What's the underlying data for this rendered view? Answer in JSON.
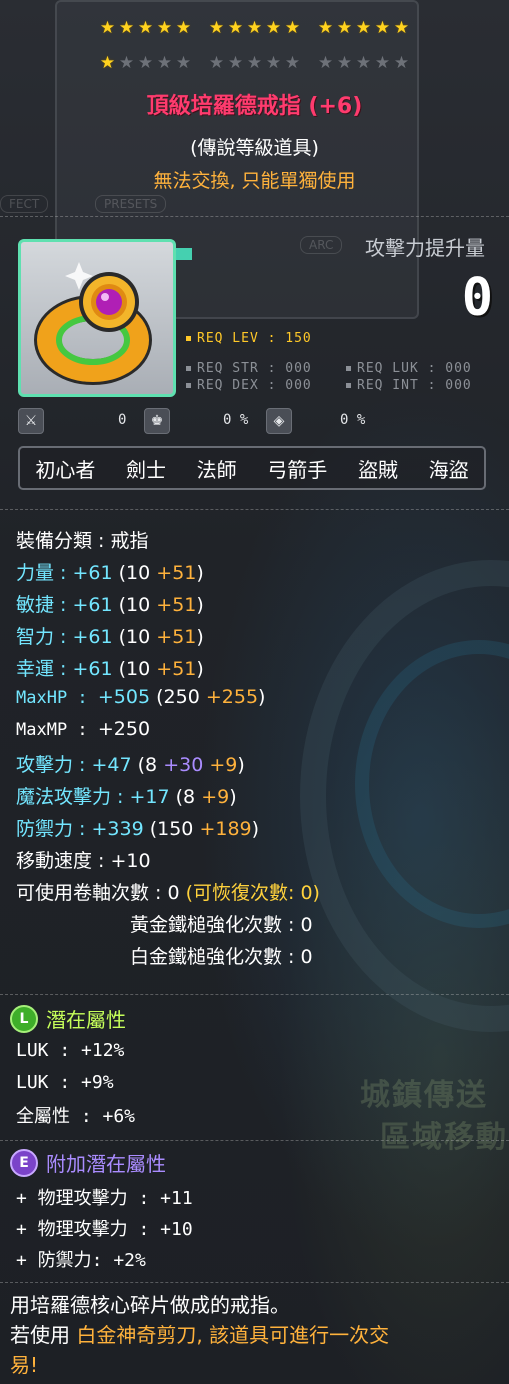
{
  "stars": {
    "total_row1": 15,
    "total_row2": 15,
    "filled_row2": 1
  },
  "item": {
    "name": "頂級培羅德戒指",
    "enhance": "(+6)",
    "grade": "(傳說等級道具)",
    "trade": "無法交換, 只能單獨使用"
  },
  "attack_increase": {
    "label": "攻擊力提升量",
    "value": "0"
  },
  "requirements": {
    "lev": "REQ LEV : 150",
    "str": "REQ STR : 000",
    "luk": "REQ LUK : 000",
    "dex": "REQ DEX : 000",
    "int": "REQ INT : 000"
  },
  "small_stats": {
    "v1": "0",
    "v2": "0 %",
    "v3": "0 %"
  },
  "jobs": [
    "初心者",
    "劍士",
    "法師",
    "弓箭手",
    "盜賊",
    "海盜"
  ],
  "category": {
    "label": "裝備分類 : ",
    "value": "戒指"
  },
  "stats": [
    {
      "label": "力量 : ",
      "total": "+61",
      "base": "(10 ",
      "bonus": "+51",
      "close": ")"
    },
    {
      "label": "敏捷 : ",
      "total": "+61",
      "base": "(10 ",
      "bonus": "+51",
      "close": ")"
    },
    {
      "label": "智力 : ",
      "total": "+61",
      "base": "(10 ",
      "bonus": "+51",
      "close": ")"
    },
    {
      "label": "幸運 : ",
      "total": "+61",
      "base": "(10 ",
      "bonus": "+51",
      "close": ")"
    },
    {
      "label": "MaxHP : ",
      "total": "+505",
      "base": "(250 ",
      "bonus": "+255",
      "close": ")"
    }
  ],
  "maxmp": {
    "label": "MaxMP : ",
    "value": "+250"
  },
  "attack": {
    "label": "攻擊力 : ",
    "total": "+47",
    "base": "(8 ",
    "star": "+30",
    "bonus": "+9",
    "close": ")"
  },
  "magic": {
    "label": "魔法攻擊力 : ",
    "total": "+17",
    "base": "(8 ",
    "bonus": "+9",
    "close": ")"
  },
  "defense": {
    "label": "防禦力 : ",
    "total": "+339",
    "base": "(150 ",
    "bonus": "+189",
    "close": ")"
  },
  "speed": {
    "label": "移動速度 : ",
    "value": "+10"
  },
  "scrolls": {
    "label": "可使用卷軸次數 : 0 ",
    "restore": "(可恢復次數: 0)"
  },
  "golden_hammer": "黃金鐵槌強化次數 : 0",
  "platinum_hammer": "白金鐵槌強化次數 : 0",
  "potential": {
    "badge": "L",
    "title": "潛在屬性",
    "lines": [
      "LUK : +12%",
      "LUK : +9%",
      "全屬性 : +6%"
    ]
  },
  "bonus_potential": {
    "badge": "E",
    "title": "附加潛在屬性",
    "lines": [
      "+ 物理攻擊力 : +11",
      "+ 物理攻擊力 : +10",
      "+ 防禦力: +2%"
    ]
  },
  "description": {
    "line1": "用培羅德核心碎片做成的戒指。",
    "prefix": "若使用 ",
    "highlight": "白金神奇剪刀, 該道具可進行一次交",
    "highlight2": "易!"
  },
  "background": {
    "tag1": "FECT",
    "tag2": "PRESETS",
    "tag3": "ARC",
    "sign1": "城鎮傳送",
    "sign2": "區域移動"
  },
  "colors": {
    "title": "#ff3b6e",
    "trade": "#ffb23c",
    "stat_name": "#73e6ff",
    "bonus": "#ffb23c",
    "star_force": "#aa8cff",
    "legendary": "#c6ff5a",
    "epic": "#aa8cff"
  }
}
